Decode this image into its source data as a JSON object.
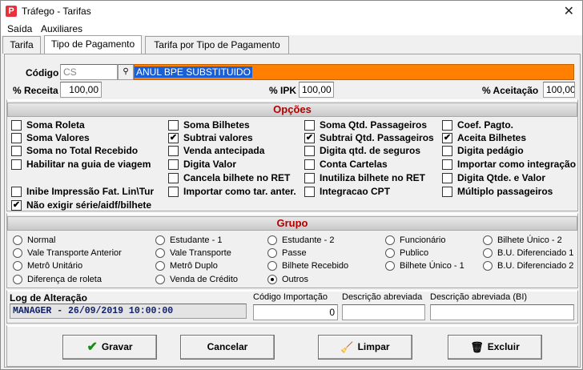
{
  "window": {
    "title": "Tráfego - Tarifas",
    "close_glyph": "✕",
    "app_icon_glyph": "P"
  },
  "menu": [
    "Saída",
    "Auxiliares"
  ],
  "tabs": [
    {
      "label": "Tarifa"
    },
    {
      "label": "Tipo de Pagamento"
    },
    {
      "label": "Tarifa por Tipo de Pagamento"
    }
  ],
  "form": {
    "codigo_label": "Código",
    "codigo_placeholder": "CS",
    "lookup_icon": "binoculars-icon",
    "descricao_value": "ANUL BPE SUBSTITUIDO",
    "receita_label": "% Receita",
    "receita_value": "100,00",
    "ipk_label": "% IPK",
    "ipk_value": "100,00",
    "aceitacao_label": "% Aceitação",
    "aceitacao_value": "100,00"
  },
  "opcoes": {
    "title": "Opções",
    "items": [
      {
        "label": "Soma Roleta",
        "checked": false
      },
      {
        "label": "Soma Valores",
        "checked": false
      },
      {
        "label": "Soma no Total Recebido",
        "checked": false
      },
      {
        "label": "Habilitar na guia de viagem",
        "checked": false
      },
      {
        "label": "Inibe Impressão Fat. Lin\\Tur",
        "checked": false
      },
      {
        "label": "Não exigir série/aidf/bilhete",
        "checked": true
      },
      {
        "label": "Soma Bilhetes",
        "checked": false
      },
      {
        "label": "Subtrai valores",
        "checked": true
      },
      {
        "label": "Venda antecipada",
        "checked": false
      },
      {
        "label": "Digita Valor",
        "checked": false
      },
      {
        "label": "Cancela bilhete no RET",
        "checked": false
      },
      {
        "label": "Importar como tar. anter.",
        "checked": false
      },
      {
        "label": "Soma Qtd. Passageiros",
        "checked": false
      },
      {
        "label": "Subtrai Qtd. Passageiros",
        "checked": true
      },
      {
        "label": "Digita qtd. de seguros",
        "checked": false
      },
      {
        "label": "Conta Cartelas",
        "checked": false
      },
      {
        "label": "Inutiliza bilhete no RET",
        "checked": false
      },
      {
        "label": "Integracao CPT",
        "checked": false
      },
      {
        "label": "Coef. Pagto.",
        "checked": false
      },
      {
        "label": "Aceita Bilhetes",
        "checked": true
      },
      {
        "label": "Digita pedágio",
        "checked": false
      },
      {
        "label": "Importar como integração",
        "checked": false
      },
      {
        "label": "Digita Qtde. e Valor",
        "checked": false
      },
      {
        "label": "Múltiplo passageiros",
        "checked": false
      }
    ]
  },
  "grupo": {
    "title": "Grupo",
    "options": [
      "Normal",
      "Vale Transporte Anterior",
      "Metrô Unitário",
      "Diferença de roleta",
      "Estudante - 1",
      "Vale Transporte",
      "Metrô Duplo",
      "Venda de Crédito",
      "Estudante - 2",
      "Passe",
      "Bilhete Recebido",
      "Outros",
      "Funcionário",
      "Publico",
      "Bilhete Único - 1",
      "Bilhete Único - 2",
      "B.U. Diferenciado 1",
      "B.U. Diferenciado 2"
    ],
    "selected": "Outros"
  },
  "footer": {
    "log_label": "Log de Alteração",
    "log_value": "MANAGER - 26/09/2019 10:00:00",
    "cod_import_label": "Código Importação",
    "cod_import_value": "0",
    "desc_abrev_label": "Descrição abreviada",
    "desc_abrev_value": "",
    "desc_abrev_bi_label": "Descrição abreviada (BI)",
    "desc_abrev_bi_value": ""
  },
  "buttons": [
    {
      "label": "Gravar",
      "icon": "checkmark-icon",
      "glyph": "✔",
      "color": "#1a8a1a"
    },
    {
      "label": "Cancelar",
      "icon": "",
      "glyph": "",
      "color": ""
    },
    {
      "label": "Limpar",
      "icon": "broom-icon",
      "glyph": "🧹",
      "color": "#7a4a1a"
    },
    {
      "label": "Excluir",
      "icon": "trash-icon",
      "glyph": "🗑",
      "color": "#333333"
    }
  ]
}
